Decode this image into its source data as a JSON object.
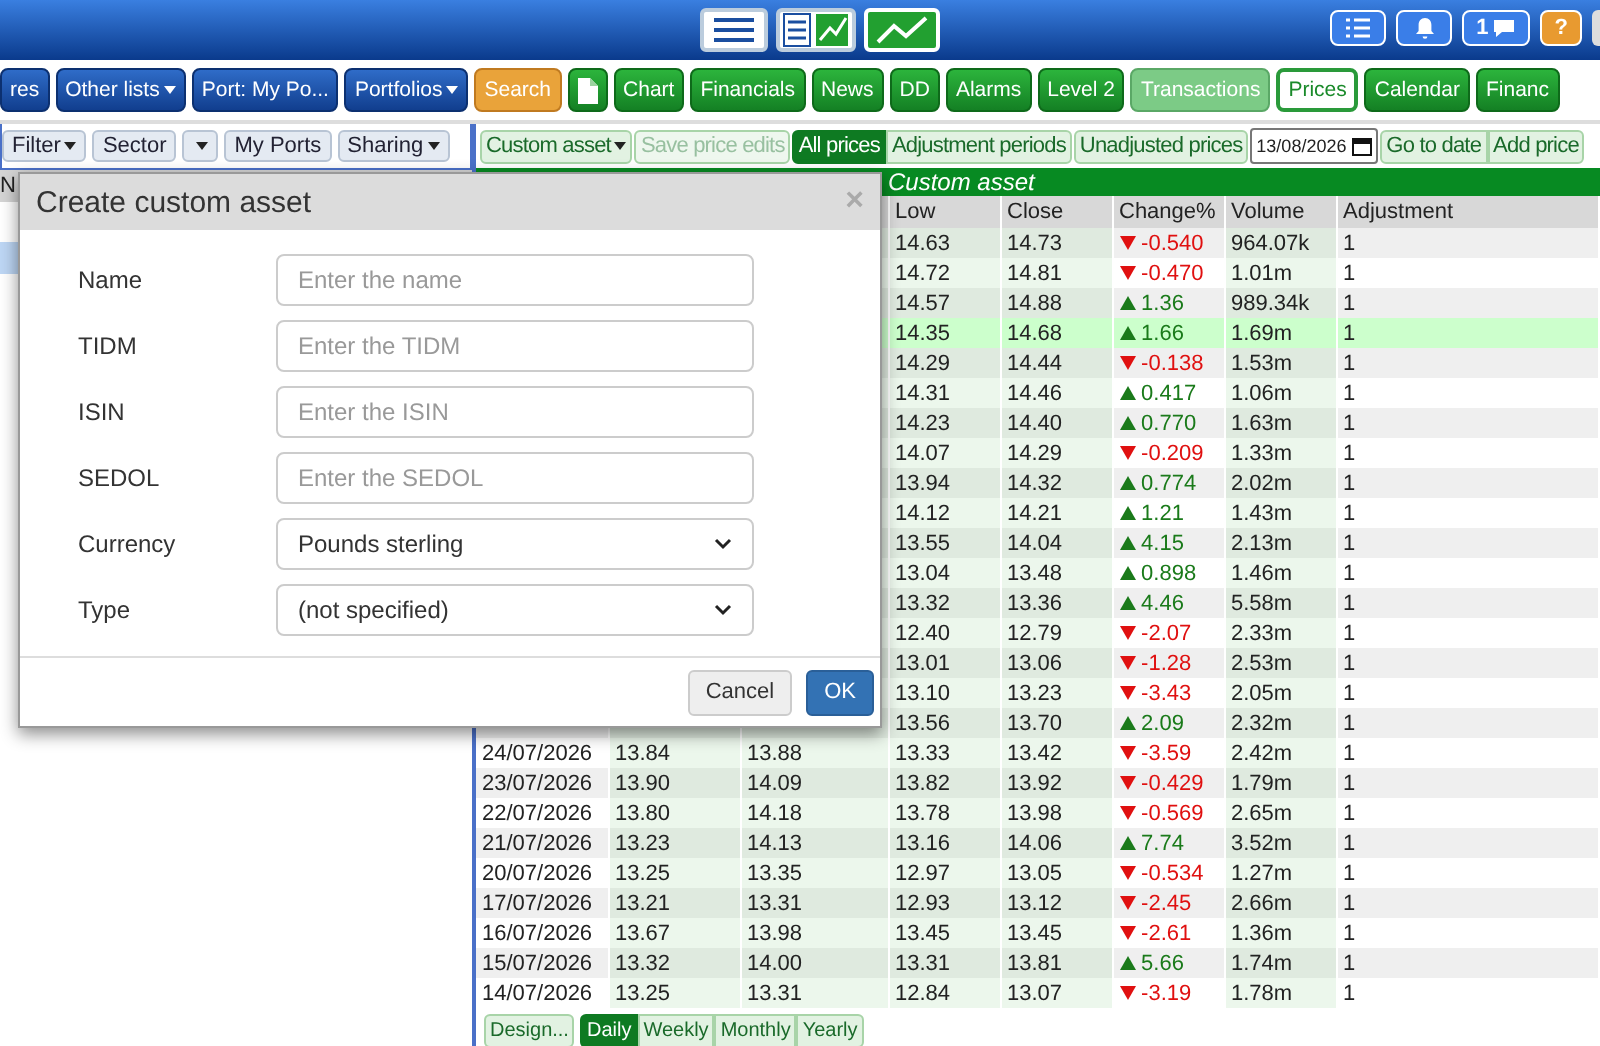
{
  "top_bar": {
    "notification_count": "1",
    "help": "?"
  },
  "nav": [
    {
      "label": "res",
      "kind": "blue",
      "selected": false,
      "caret": false
    },
    {
      "label": "Other lists",
      "kind": "blue",
      "selected": false,
      "caret": true
    },
    {
      "label": "Port: My Po...",
      "kind": "blue",
      "selected": false,
      "caret": false
    },
    {
      "label": "Portfolios",
      "kind": "blue",
      "selected": false,
      "caret": true
    },
    {
      "label": "Search",
      "kind": "orange",
      "selected": false,
      "caret": false
    },
    {
      "kind": "doc",
      "selected": false,
      "caret": false
    },
    {
      "label": "Chart",
      "kind": "green",
      "selected": false,
      "caret": false
    },
    {
      "label": "Financials",
      "kind": "green",
      "selected": false,
      "caret": false
    },
    {
      "label": "News",
      "kind": "green",
      "selected": false,
      "caret": false
    },
    {
      "label": "DD",
      "kind": "green",
      "selected": false,
      "caret": false
    },
    {
      "label": "Alarms",
      "kind": "green",
      "selected": false,
      "caret": false
    },
    {
      "label": "Level 2",
      "kind": "green",
      "selected": false,
      "caret": false
    },
    {
      "label": "Transactions",
      "kind": "faded",
      "selected": false,
      "caret": false
    },
    {
      "label": "Prices",
      "kind": "green",
      "selected": true,
      "caret": false
    },
    {
      "label": "Calendar",
      "kind": "green",
      "selected": false,
      "caret": false
    },
    {
      "label": "Financ",
      "kind": "green",
      "selected": false,
      "caret": false
    }
  ],
  "left_panel": {
    "toolbar": [
      {
        "label": "Filter",
        "caret": true
      },
      {
        "label": "Sector",
        "caret": false
      },
      {
        "caret": true
      },
      {
        "label": "My Ports",
        "caret": false
      },
      {
        "label": "Sharing",
        "caret": true
      }
    ],
    "column_1": "N"
  },
  "prices_toolbar": {
    "custom_asset": "Custom asset",
    "save": {
      "label": "Save price edits",
      "disabled": true
    },
    "views": [
      {
        "label": "All prices",
        "selected": true
      },
      {
        "label": "Adjustment periods",
        "selected": false
      }
    ],
    "unadjusted": "Unadjusted prices",
    "date": "13/08/2026",
    "go_to_date": "Go to date",
    "add_price": "Add price"
  },
  "table": {
    "title": "Custom asset",
    "columns": [
      "Low",
      "Close",
      "Change%",
      "Volume",
      "Adjustment"
    ],
    "rows": [
      {
        "low": "14.63",
        "close": "14.73",
        "change": "-0.540",
        "kind": "down",
        "volume": "964.07k",
        "adjustment": "1",
        "selected": false
      },
      {
        "low": "14.72",
        "close": "14.81",
        "change": "-0.470",
        "kind": "down",
        "volume": "1.01m",
        "adjustment": "1",
        "selected": false
      },
      {
        "low": "14.57",
        "close": "14.88",
        "change": "1.36",
        "kind": "up",
        "volume": "989.34k",
        "adjustment": "1",
        "selected": false
      },
      {
        "low": "14.35",
        "close": "14.68",
        "change": "1.66",
        "kind": "up",
        "volume": "1.69m",
        "adjustment": "1",
        "selected": true
      },
      {
        "low": "14.29",
        "close": "14.44",
        "change": "-0.138",
        "kind": "down",
        "volume": "1.53m",
        "adjustment": "1",
        "selected": false
      },
      {
        "low": "14.31",
        "close": "14.46",
        "change": "0.417",
        "kind": "up",
        "volume": "1.06m",
        "adjustment": "1",
        "selected": false
      },
      {
        "low": "14.23",
        "close": "14.40",
        "change": "0.770",
        "kind": "up",
        "volume": "1.63m",
        "adjustment": "1",
        "selected": false
      },
      {
        "low": "14.07",
        "close": "14.29",
        "change": "-0.209",
        "kind": "down",
        "volume": "1.33m",
        "adjustment": "1",
        "selected": false
      },
      {
        "low": "13.94",
        "close": "14.32",
        "change": "0.774",
        "kind": "up",
        "volume": "2.02m",
        "adjustment": "1",
        "selected": false
      },
      {
        "low": "14.12",
        "close": "14.21",
        "change": "1.21",
        "kind": "up",
        "volume": "1.43m",
        "adjustment": "1",
        "selected": false
      },
      {
        "low": "13.55",
        "close": "14.04",
        "change": "4.15",
        "kind": "up",
        "volume": "2.13m",
        "adjustment": "1",
        "selected": false
      },
      {
        "low": "13.04",
        "close": "13.48",
        "change": "0.898",
        "kind": "up",
        "volume": "1.46m",
        "adjustment": "1",
        "selected": false
      },
      {
        "low": "13.32",
        "close": "13.36",
        "change": "4.46",
        "kind": "up",
        "volume": "5.58m",
        "adjustment": "1",
        "selected": false
      },
      {
        "low": "12.40",
        "close": "12.79",
        "change": "-2.07",
        "kind": "down",
        "volume": "2.33m",
        "adjustment": "1",
        "selected": false
      },
      {
        "low": "13.01",
        "close": "13.06",
        "change": "-1.28",
        "kind": "down",
        "volume": "2.53m",
        "adjustment": "1",
        "selected": false
      },
      {
        "low": "13.10",
        "close": "13.23",
        "change": "-3.43",
        "kind": "down",
        "volume": "2.05m",
        "adjustment": "1",
        "selected": false
      },
      {
        "low": "13.56",
        "close": "13.70",
        "change": "2.09",
        "kind": "up",
        "volume": "2.32m",
        "adjustment": "1",
        "selected": false
      },
      {
        "date": "24/07/2026",
        "open": "13.84",
        "high": "13.88",
        "low": "13.33",
        "close": "13.42",
        "change": "-3.59",
        "kind": "down",
        "volume": "2.42m",
        "adjustment": "1",
        "selected": false
      },
      {
        "date": "23/07/2026",
        "open": "13.90",
        "high": "14.09",
        "low": "13.82",
        "close": "13.92",
        "change": "-0.429",
        "kind": "down",
        "volume": "1.79m",
        "adjustment": "1",
        "selected": false
      },
      {
        "date": "22/07/2026",
        "open": "13.80",
        "high": "14.18",
        "low": "13.78",
        "close": "13.98",
        "change": "-0.569",
        "kind": "down",
        "volume": "2.65m",
        "adjustment": "1",
        "selected": false
      },
      {
        "date": "21/07/2026",
        "open": "13.23",
        "high": "14.13",
        "low": "13.16",
        "close": "14.06",
        "change": "7.74",
        "kind": "up",
        "volume": "3.52m",
        "adjustment": "1",
        "selected": false
      },
      {
        "date": "20/07/2026",
        "open": "13.25",
        "high": "13.35",
        "low": "12.97",
        "close": "13.05",
        "change": "-0.534",
        "kind": "down",
        "volume": "1.27m",
        "adjustment": "1",
        "selected": false
      },
      {
        "date": "17/07/2026",
        "open": "13.21",
        "high": "13.31",
        "low": "12.93",
        "close": "13.12",
        "change": "-2.45",
        "kind": "down",
        "volume": "2.66m",
        "adjustment": "1",
        "selected": false
      },
      {
        "date": "16/07/2026",
        "open": "13.67",
        "high": "13.98",
        "low": "13.45",
        "close": "13.45",
        "change": "-2.61",
        "kind": "down",
        "volume": "1.36m",
        "adjustment": "1",
        "selected": false
      },
      {
        "date": "15/07/2026",
        "open": "13.32",
        "high": "14.00",
        "low": "13.31",
        "close": "13.81",
        "change": "5.66",
        "kind": "up",
        "volume": "1.74m",
        "adjustment": "1",
        "selected": false
      },
      {
        "date": "14/07/2026",
        "open": "13.25",
        "high": "13.31",
        "low": "12.84",
        "close": "13.07",
        "change": "-3.19",
        "kind": "down",
        "volume": "1.78m",
        "adjustment": "1",
        "selected": false
      }
    ]
  },
  "bottom_bar": {
    "design": "Design...",
    "periods": [
      {
        "label": "Daily",
        "selected": true
      },
      {
        "label": "Weekly",
        "selected": false
      },
      {
        "label": "Monthly",
        "selected": false
      },
      {
        "label": "Yearly",
        "selected": false
      }
    ]
  },
  "dialog": {
    "title": "Create custom asset",
    "close": "×",
    "fields": [
      {
        "label": "Name",
        "kind": "text",
        "placeholder": "Enter the name"
      },
      {
        "label": "TIDM",
        "kind": "text",
        "placeholder": "Enter the TIDM"
      },
      {
        "label": "ISIN",
        "kind": "text",
        "placeholder": "Enter the ISIN"
      },
      {
        "label": "SEDOL",
        "kind": "text",
        "placeholder": "Enter the SEDOL"
      },
      {
        "label": "Currency",
        "kind": "select",
        "value": "Pounds sterling"
      },
      {
        "label": "Type",
        "kind": "select",
        "value": "(not specified)"
      }
    ],
    "cancel": "Cancel",
    "ok": "OK"
  }
}
